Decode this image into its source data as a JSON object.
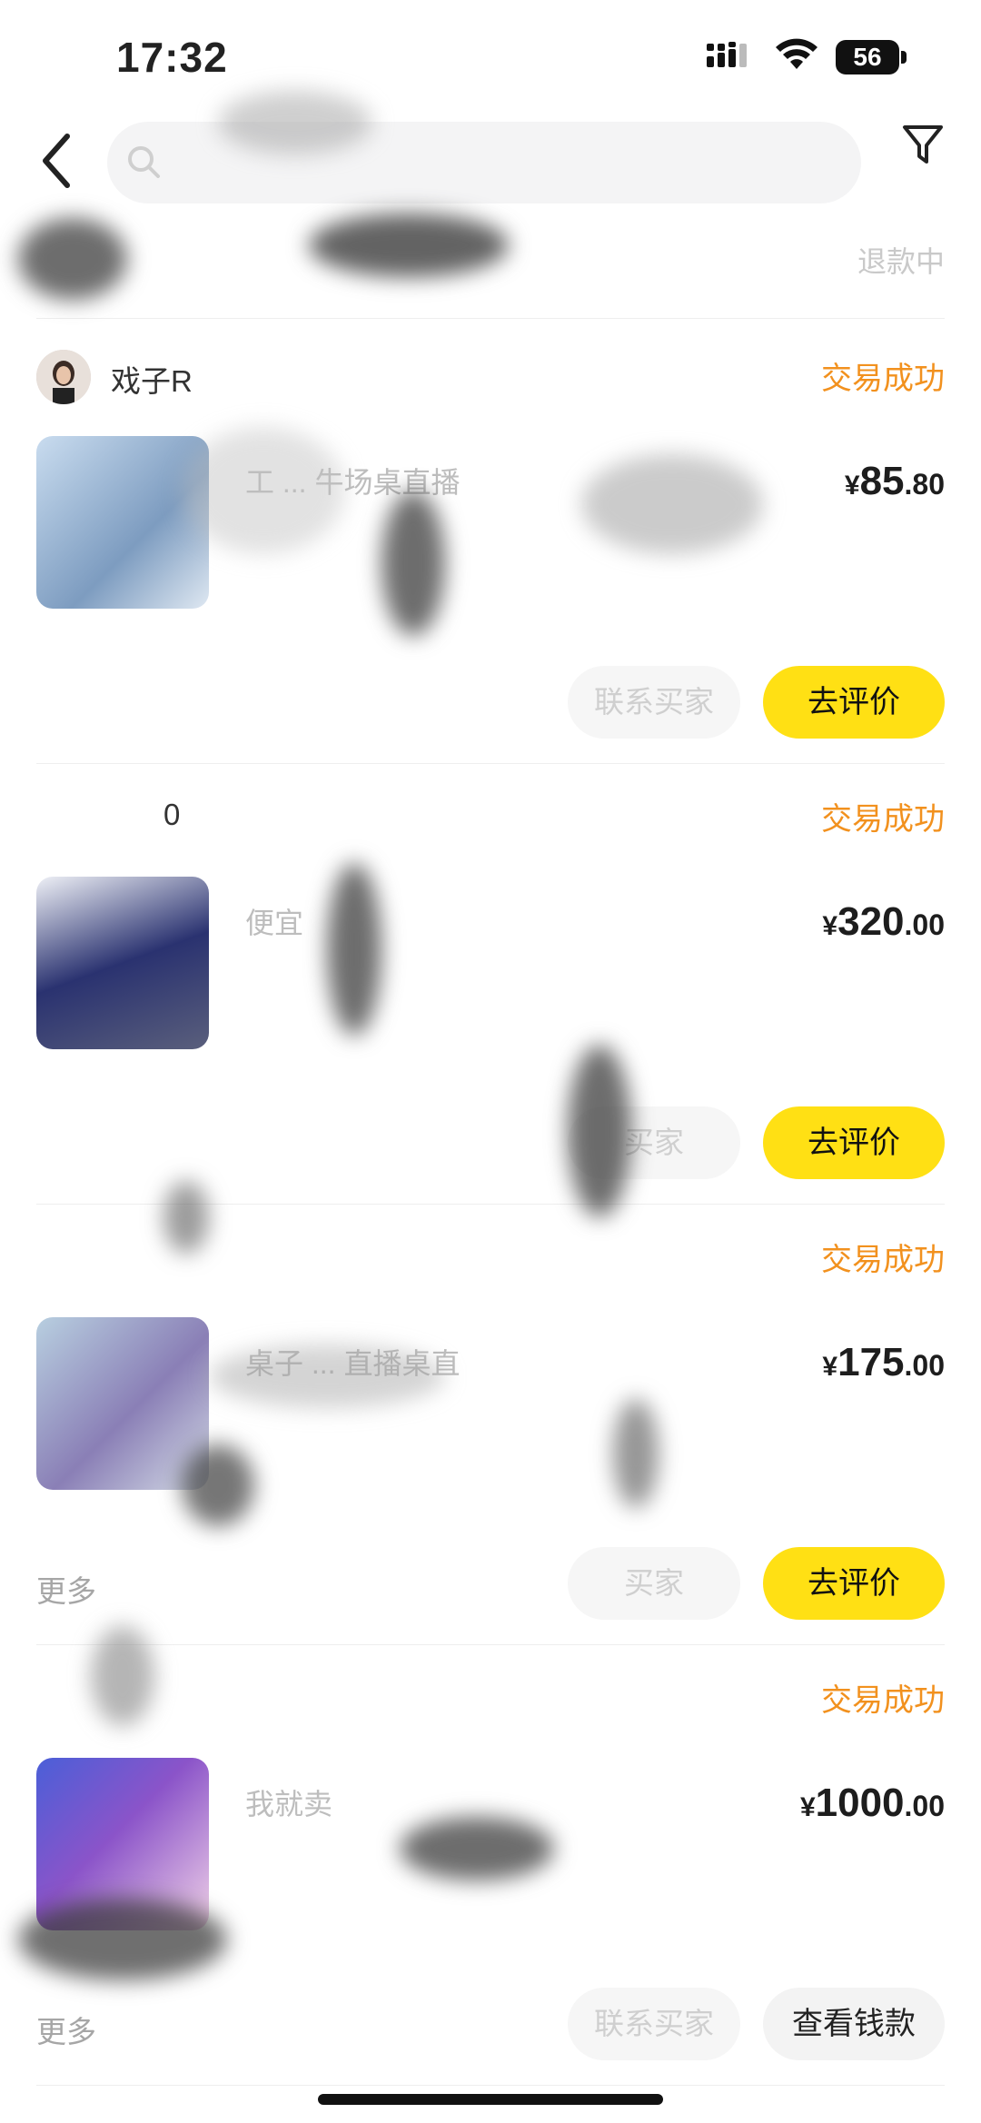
{
  "status_bar": {
    "time": "17:32",
    "battery": "56"
  },
  "nav": {
    "search_placeholder": "",
    "back_icon": "chevron-left-icon",
    "filter_icon": "filter-icon"
  },
  "top_row": {
    "status": "退款中"
  },
  "orders": [
    {
      "seller": "戏子R",
      "status": "交易成功",
      "title": "工 ... 牛场桌直播",
      "price_currency": "¥",
      "price_int": "85",
      "price_dec": ".80",
      "more": "",
      "secondary_button": "联系买家",
      "primary_button": "去评价",
      "primary_style": "yellow"
    },
    {
      "seller": "0",
      "status": "交易成功",
      "title": "便宜",
      "price_currency": "¥",
      "price_int": "320",
      "price_dec": ".00",
      "more": "",
      "secondary_button": "买家",
      "primary_button": "去评价",
      "primary_style": "yellow"
    },
    {
      "seller": "",
      "status": "交易成功",
      "title": "桌子 ... 直播桌直",
      "price_currency": "¥",
      "price_int": "175",
      "price_dec": ".00",
      "more": "更多",
      "secondary_button": "买家",
      "primary_button": "去评价",
      "primary_style": "yellow"
    },
    {
      "seller": "",
      "status": "交易成功",
      "title": "我就卖",
      "price_currency": "¥",
      "price_int": "1000",
      "price_dec": ".00",
      "more": "更多",
      "secondary_button": "联系买家",
      "primary_button": "查看钱款",
      "primary_style": "gray"
    }
  ],
  "colors": {
    "status_orange": "#f2911e",
    "primary_yellow": "#ffe014"
  }
}
